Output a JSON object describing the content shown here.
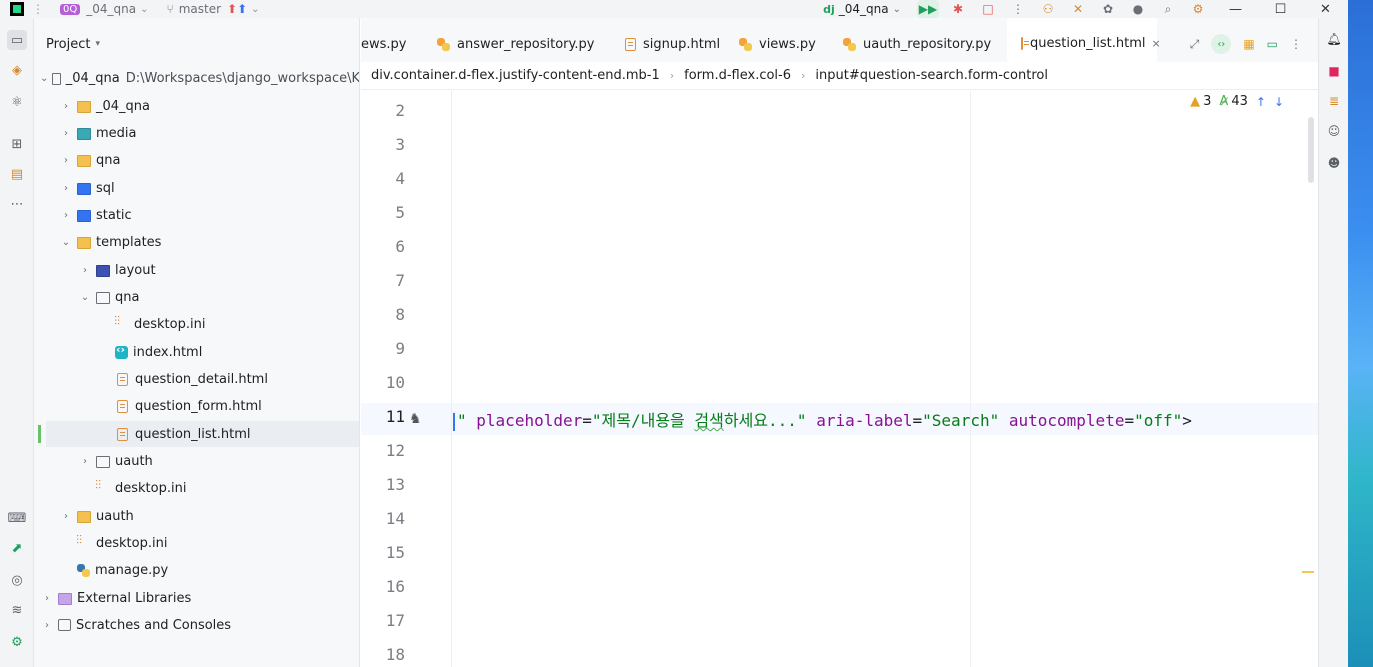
{
  "titlebar": {
    "project_badge": "0Q",
    "project_name": "_04_qna",
    "branch": "master",
    "run_config": "_04_qna",
    "window_controls": [
      "—",
      "☐",
      "✕"
    ]
  },
  "project_panel": {
    "title": "Project",
    "tree": [
      {
        "label": "_04_qna",
        "path": "D:\\Workspaces\\django_workspace\\K",
        "icon": "folder",
        "arrow": "down"
      },
      {
        "label": "_04_qna",
        "icon": "folder-yellow",
        "arrow": "right"
      },
      {
        "label": "media",
        "icon": "folder-teal",
        "arrow": "right"
      },
      {
        "label": "qna",
        "icon": "folder-yellow",
        "arrow": "right"
      },
      {
        "label": "sql",
        "icon": "folder-blue",
        "arrow": "right"
      },
      {
        "label": "static",
        "icon": "folder-blue",
        "arrow": "right"
      },
      {
        "label": "templates",
        "icon": "folder-yellow",
        "arrow": "down"
      },
      {
        "label": "layout",
        "icon": "folder-navy",
        "arrow": "right"
      },
      {
        "label": "qna",
        "icon": "folder",
        "arrow": "down"
      },
      {
        "label": "desktop.ini",
        "icon": "config-file-icon",
        "arrow": ""
      },
      {
        "label": "index.html",
        "icon": "vue-file-icon",
        "arrow": ""
      },
      {
        "label": "question_detail.html",
        "icon": "html-file-icon",
        "arrow": ""
      },
      {
        "label": "question_form.html",
        "icon": "html-file-icon",
        "arrow": ""
      },
      {
        "label": "question_list.html",
        "icon": "html-file-icon",
        "arrow": "",
        "selected": true
      },
      {
        "label": "uauth",
        "icon": "folder",
        "arrow": "right"
      },
      {
        "label": "desktop.ini",
        "icon": "config-file-icon",
        "arrow": ""
      },
      {
        "label": "uauth",
        "icon": "folder-yellow",
        "arrow": "right"
      },
      {
        "label": "desktop.ini",
        "icon": "config-file-icon",
        "arrow": ""
      },
      {
        "label": "manage.py",
        "icon": "python-file-icon",
        "arrow": ""
      },
      {
        "label": "External Libraries",
        "icon": "library-icon",
        "arrow": "right"
      },
      {
        "label": "Scratches and Consoles",
        "icon": "scratch-icon",
        "arrow": "right"
      }
    ]
  },
  "tabs": [
    {
      "label": "ews.py",
      "icon": "python-file-icon"
    },
    {
      "label": "answer_repository.py",
      "icon": "python-file-icon"
    },
    {
      "label": "signup.html",
      "icon": "html-file-icon"
    },
    {
      "label": "views.py",
      "icon": "python-file-icon"
    },
    {
      "label": "uauth_repository.py",
      "icon": "python-file-icon"
    },
    {
      "label": "question_list.html",
      "icon": "html-file-icon",
      "active": true,
      "close": "×"
    }
  ],
  "breadcrumb": [
    "div.container.d-flex.justify-content-end.mb-1",
    "form.d-flex.col-6",
    "input#question-search.form-control"
  ],
  "editor": {
    "line_numbers": [
      "2",
      "3",
      "4",
      "5",
      "6",
      "7",
      "8",
      "9",
      "10",
      "11",
      "12",
      "13",
      "14",
      "15",
      "16",
      "17",
      "18"
    ],
    "current_line": "11",
    "code": {
      "q0": "\"",
      "attr1": "placeholder",
      "eq1": "=",
      "val1a": "\"제목/내용을 ",
      "val1b": "검색",
      "val1c": "하세요...\"",
      "attr2": "aria-label",
      "eq2": "=",
      "val2": "\"Search\"",
      "attr3": "autocomplete",
      "eq3": "=",
      "val3": "\"off\"",
      "end": ">"
    },
    "inspections": {
      "warnings": "3",
      "typos": "43"
    }
  }
}
